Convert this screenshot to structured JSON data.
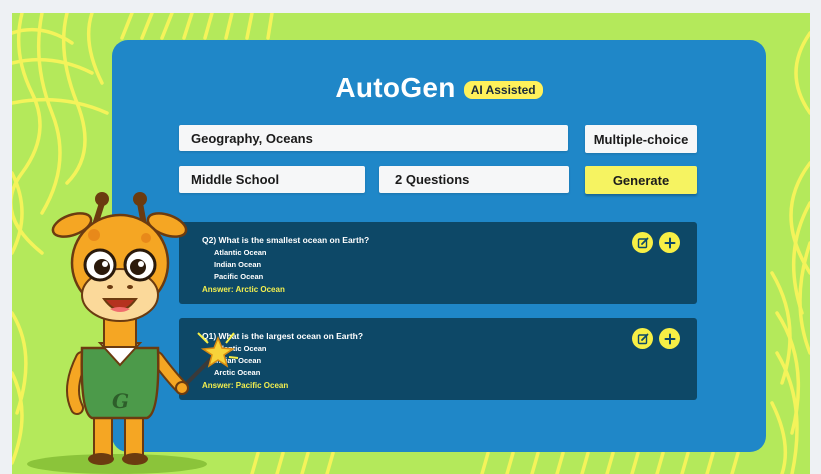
{
  "app": {
    "title": "AutoGen",
    "badge": "AI Assisted"
  },
  "form": {
    "topic": "Geography, Oceans",
    "question_type": "Multiple-choice",
    "level": "Middle School",
    "count": "2 Questions",
    "generate_label": "Generate"
  },
  "questions": [
    {
      "question": "Q2) What is the smallest ocean on Earth?",
      "options": [
        "Atlantic Ocean",
        "Indian Ocean",
        "Pacific Ocean"
      ],
      "answer": "Answer: Arctic Ocean"
    },
    {
      "question": "Q1) What is the largest ocean on Earth?",
      "options": [
        "Atlantic Ocean",
        "Indian Ocean",
        "Arctic Ocean"
      ],
      "answer": "Answer: Pacific Ocean"
    }
  ],
  "mascot": {
    "vest_letter": "G"
  },
  "icons": {
    "edit": "edit-icon",
    "add": "plus-icon"
  },
  "colors": {
    "background": "#b4e95b",
    "panel": "#1f87c8",
    "card": "#0d4867",
    "accent": "#f6f361",
    "answer": "#f3ef4f"
  }
}
